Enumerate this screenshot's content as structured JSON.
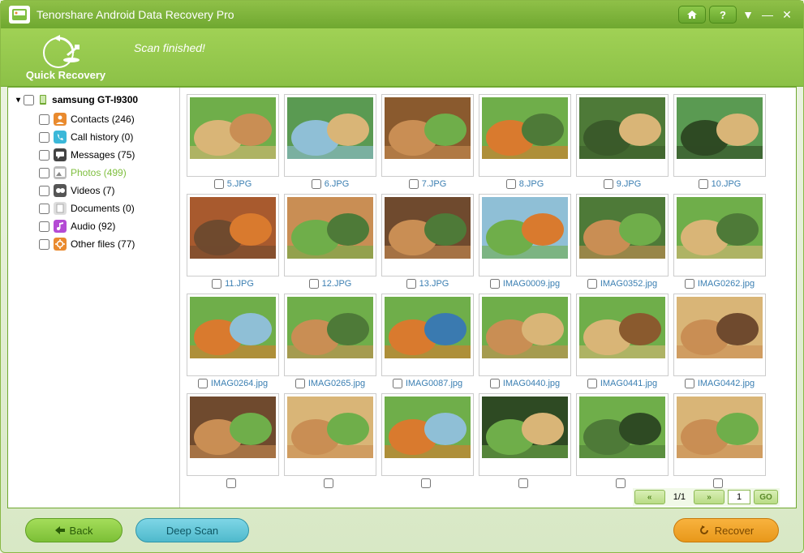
{
  "app_title": "Tenorshare Android Data Recovery Pro",
  "banner": {
    "mode": "Quick Recovery",
    "status": "Scan finished!"
  },
  "device": "samsung GT-I9300",
  "categories": [
    {
      "name": "Contacts",
      "count": 246,
      "color": "#e98a2e",
      "icon": "user"
    },
    {
      "name": "Call history",
      "count": 0,
      "color": "#3bb8d9",
      "icon": "phone"
    },
    {
      "name": "Messages",
      "count": 75,
      "color": "#444",
      "icon": "msg"
    },
    {
      "name": "Photos",
      "count": 499,
      "color": "#bbb",
      "icon": "photo",
      "selected": true
    },
    {
      "name": "Videos",
      "count": 7,
      "color": "#555",
      "icon": "video"
    },
    {
      "name": "Documents",
      "count": 0,
      "color": "#ddd",
      "icon": "doc"
    },
    {
      "name": "Audio",
      "count": 92,
      "color": "#b44bd4",
      "icon": "audio"
    },
    {
      "name": "Other files",
      "count": 77,
      "color": "#e98a2e",
      "icon": "other"
    }
  ],
  "thumbs": [
    {
      "name": "5.JPG",
      "p": "a"
    },
    {
      "name": "6.JPG",
      "p": "b"
    },
    {
      "name": "7.JPG",
      "p": "c"
    },
    {
      "name": "8.JPG",
      "p": "d"
    },
    {
      "name": "9.JPG",
      "p": "e"
    },
    {
      "name": "10.JPG",
      "p": "f"
    },
    {
      "name": "11.JPG",
      "p": "g"
    },
    {
      "name": "12.JPG",
      "p": "h"
    },
    {
      "name": "13.JPG",
      "p": "i"
    },
    {
      "name": "IMAG0009.jpg",
      "p": "j"
    },
    {
      "name": "IMAG0352.jpg",
      "p": "k"
    },
    {
      "name": "IMAG0262.jpg",
      "p": "l"
    },
    {
      "name": "IMAG0264.jpg",
      "p": "m"
    },
    {
      "name": "IMAG0265.jpg",
      "p": "n"
    },
    {
      "name": "IMAG0087.jpg",
      "p": "o"
    },
    {
      "name": "IMAG0440.jpg",
      "p": "p"
    },
    {
      "name": "IMAG0441.jpg",
      "p": "q"
    },
    {
      "name": "IMAG0442.jpg",
      "p": "r"
    },
    {
      "name": "",
      "p": "s"
    },
    {
      "name": "",
      "p": "t"
    },
    {
      "name": "",
      "p": "u"
    },
    {
      "name": "",
      "p": "v"
    },
    {
      "name": "",
      "p": "w"
    },
    {
      "name": "",
      "p": "x"
    }
  ],
  "pager": {
    "prev": "«",
    "next": "»",
    "info": "1/1",
    "value": "1",
    "go": "GO"
  },
  "buttons": {
    "back": "Back",
    "deep": "Deep Scan",
    "recover": "Recover"
  }
}
